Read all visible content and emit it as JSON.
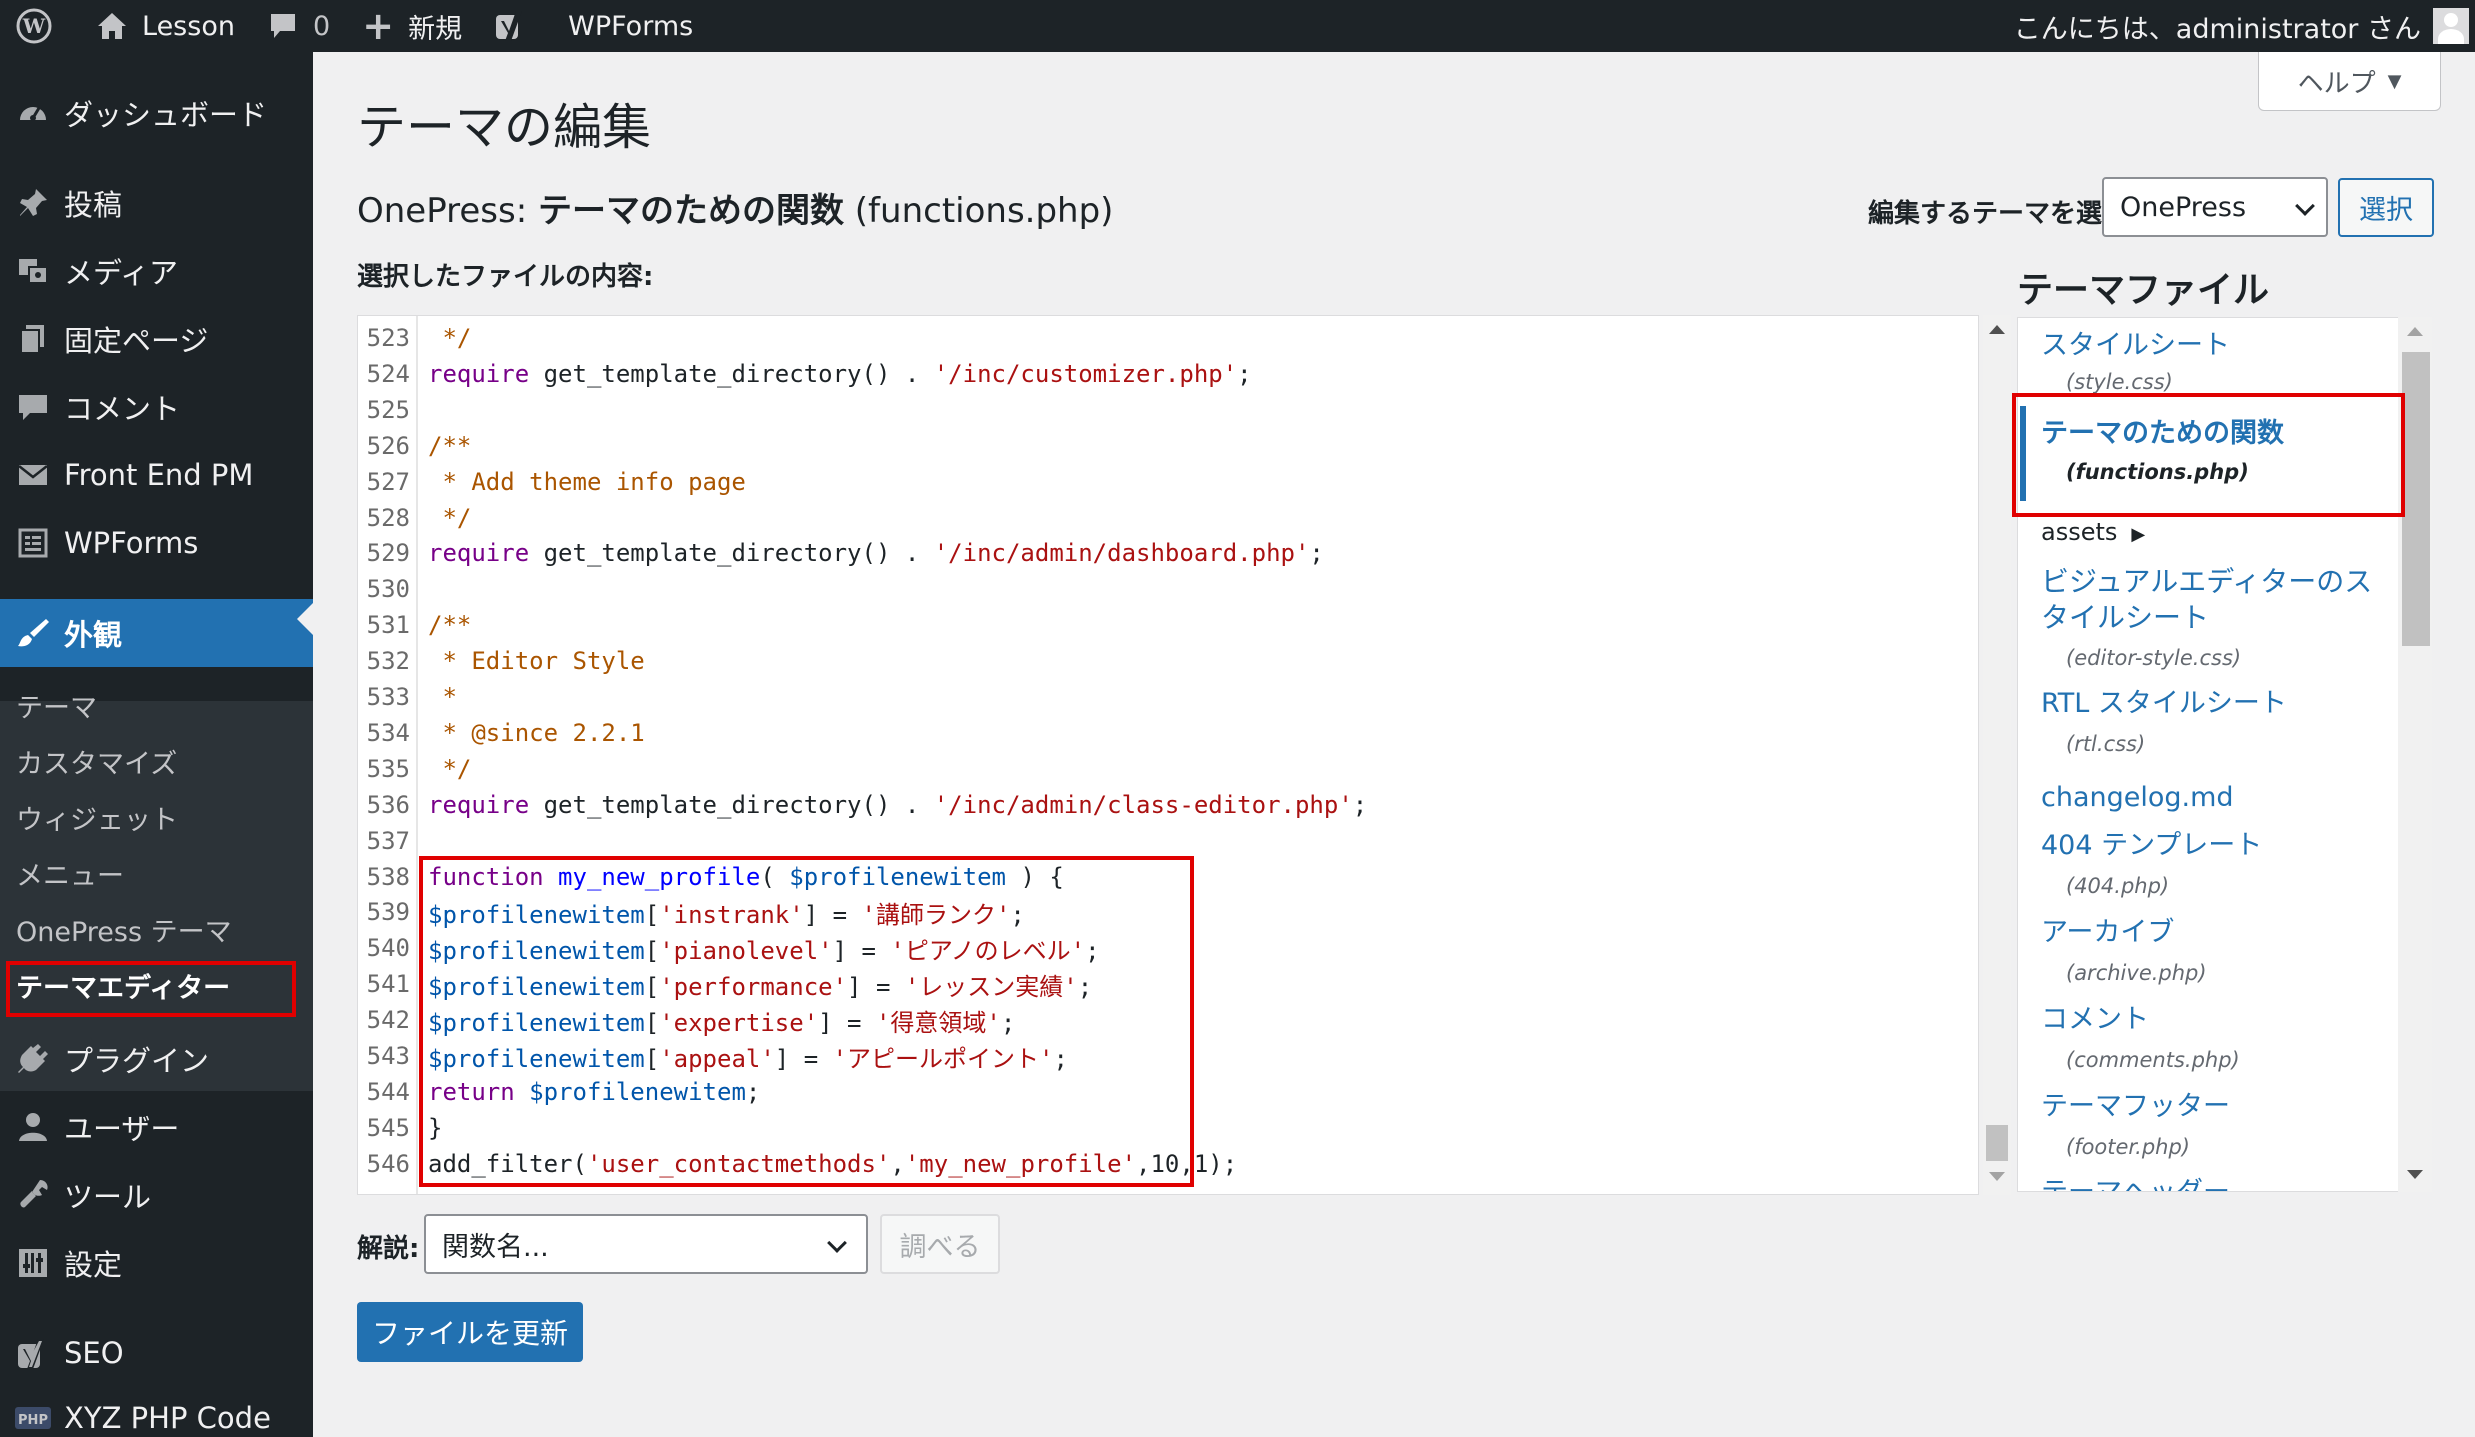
{
  "adminbar": {
    "site_name": "Lesson",
    "comments_count": "0",
    "new_label": "新規",
    "wpforms_label": "WPForms",
    "greeting": "こんにちは、administrator さん"
  },
  "sidebar": {
    "items": [
      {
        "label": "ダッシュボード",
        "icon": "dashboard-icon"
      },
      {
        "label": "投稿",
        "icon": "pin-icon"
      },
      {
        "label": "メディア",
        "icon": "media-icon"
      },
      {
        "label": "固定ページ",
        "icon": "page-icon"
      },
      {
        "label": "コメント",
        "icon": "comment-icon"
      },
      {
        "label": "Front End PM",
        "icon": "mail-icon"
      },
      {
        "label": "WPForms",
        "icon": "forms-icon"
      },
      {
        "label": "外観",
        "icon": "brush-icon"
      },
      {
        "label": "プラグイン",
        "icon": "plugin-icon"
      },
      {
        "label": "ユーザー",
        "icon": "user-icon"
      },
      {
        "label": "ツール",
        "icon": "wrench-icon"
      },
      {
        "label": "設定",
        "icon": "settings-icon"
      },
      {
        "label": "SEO",
        "icon": "yoast-icon"
      },
      {
        "label": "XYZ PHP Code",
        "icon": "php-icon"
      }
    ],
    "submenu": [
      "テーマ",
      "カスタマイズ",
      "ウィジェット",
      "メニュー",
      "OnePress テーマ",
      "テーマエディター"
    ]
  },
  "help_label": "ヘルプ",
  "page_title": "テーマの編集",
  "file_heading": {
    "theme": "OnePress:",
    "file": "テーマのための関数",
    "filename": "(functions.php)"
  },
  "theme_select": {
    "label": "編集するテーマを選択:",
    "value": "OnePress",
    "button": "選択"
  },
  "content_label": "選択したファイルの内容:",
  "code_lines": [
    {
      "n": "523",
      "tokens": [
        {
          "t": " */",
          "c": "com"
        }
      ]
    },
    {
      "n": "524",
      "tokens": [
        {
          "t": "require",
          "c": "kw"
        },
        {
          "t": " get_template_directory() . ",
          "c": "plain"
        },
        {
          "t": "'/inc/customizer.php'",
          "c": "str"
        },
        {
          "t": ";",
          "c": "plain"
        }
      ]
    },
    {
      "n": "525",
      "tokens": []
    },
    {
      "n": "526",
      "tokens": [
        {
          "t": "/**",
          "c": "com"
        }
      ]
    },
    {
      "n": "527",
      "tokens": [
        {
          "t": " * Add theme info page",
          "c": "com"
        }
      ]
    },
    {
      "n": "528",
      "tokens": [
        {
          "t": " */",
          "c": "com"
        }
      ]
    },
    {
      "n": "529",
      "tokens": [
        {
          "t": "require",
          "c": "kw"
        },
        {
          "t": " get_template_directory() . ",
          "c": "plain"
        },
        {
          "t": "'/inc/admin/dashboard.php'",
          "c": "str"
        },
        {
          "t": ";",
          "c": "plain"
        }
      ]
    },
    {
      "n": "530",
      "tokens": []
    },
    {
      "n": "531",
      "tokens": [
        {
          "t": "/**",
          "c": "com"
        }
      ]
    },
    {
      "n": "532",
      "tokens": [
        {
          "t": " * Editor Style",
          "c": "com"
        }
      ]
    },
    {
      "n": "533",
      "tokens": [
        {
          "t": " *",
          "c": "com"
        }
      ]
    },
    {
      "n": "534",
      "tokens": [
        {
          "t": " * @since 2.2.1",
          "c": "com"
        }
      ]
    },
    {
      "n": "535",
      "tokens": [
        {
          "t": " */",
          "c": "com"
        }
      ]
    },
    {
      "n": "536",
      "tokens": [
        {
          "t": "require",
          "c": "kw"
        },
        {
          "t": " get_template_directory() . ",
          "c": "plain"
        },
        {
          "t": "'/inc/admin/class-editor.php'",
          "c": "str"
        },
        {
          "t": ";",
          "c": "plain"
        }
      ]
    },
    {
      "n": "537",
      "tokens": []
    },
    {
      "n": "538",
      "tokens": [
        {
          "t": "function",
          "c": "kw"
        },
        {
          "t": " my_new_profile",
          "c": "def"
        },
        {
          "t": "( ",
          "c": "plain"
        },
        {
          "t": "$profilenewitem",
          "c": "var"
        },
        {
          "t": " ) {",
          "c": "plain"
        }
      ]
    },
    {
      "n": "539",
      "tokens": [
        {
          "t": "$profilenewitem",
          "c": "var"
        },
        {
          "t": "[",
          "c": "plain"
        },
        {
          "t": "'instrank'",
          "c": "str"
        },
        {
          "t": "] = ",
          "c": "plain"
        },
        {
          "t": "'講師ランク'",
          "c": "str"
        },
        {
          "t": ";",
          "c": "plain"
        }
      ]
    },
    {
      "n": "540",
      "tokens": [
        {
          "t": "$profilenewitem",
          "c": "var"
        },
        {
          "t": "[",
          "c": "plain"
        },
        {
          "t": "'pianolevel'",
          "c": "str"
        },
        {
          "t": "] = ",
          "c": "plain"
        },
        {
          "t": "'ピアノのレベル'",
          "c": "str"
        },
        {
          "t": ";",
          "c": "plain"
        }
      ]
    },
    {
      "n": "541",
      "tokens": [
        {
          "t": "$profilenewitem",
          "c": "var"
        },
        {
          "t": "[",
          "c": "plain"
        },
        {
          "t": "'performance'",
          "c": "str"
        },
        {
          "t": "] = ",
          "c": "plain"
        },
        {
          "t": "'レッスン実績'",
          "c": "str"
        },
        {
          "t": ";",
          "c": "plain"
        }
      ]
    },
    {
      "n": "542",
      "tokens": [
        {
          "t": "$profilenewitem",
          "c": "var"
        },
        {
          "t": "[",
          "c": "plain"
        },
        {
          "t": "'expertise'",
          "c": "str"
        },
        {
          "t": "] = ",
          "c": "plain"
        },
        {
          "t": "'得意領域'",
          "c": "str"
        },
        {
          "t": ";",
          "c": "plain"
        }
      ]
    },
    {
      "n": "543",
      "tokens": [
        {
          "t": "$profilenewitem",
          "c": "var"
        },
        {
          "t": "[",
          "c": "plain"
        },
        {
          "t": "'appeal'",
          "c": "str"
        },
        {
          "t": "] = ",
          "c": "plain"
        },
        {
          "t": "'アピールポイント'",
          "c": "str"
        },
        {
          "t": ";",
          "c": "plain"
        }
      ]
    },
    {
      "n": "544",
      "tokens": [
        {
          "t": "return",
          "c": "kw"
        },
        {
          "t": " ",
          "c": "plain"
        },
        {
          "t": "$profilenewitem",
          "c": "var"
        },
        {
          "t": ";",
          "c": "plain"
        }
      ]
    },
    {
      "n": "545",
      "tokens": [
        {
          "t": "}",
          "c": "plain"
        }
      ]
    },
    {
      "n": "546",
      "tokens": [
        {
          "t": "add_filter(",
          "c": "plain"
        },
        {
          "t": "'user_contactmethods'",
          "c": "str"
        },
        {
          "t": ",",
          "c": "plain"
        },
        {
          "t": "'my_new_profile'",
          "c": "str"
        },
        {
          "t": ",10,1);",
          "c": "plain"
        }
      ]
    }
  ],
  "files_title": "テーマファイル",
  "theme_files": [
    {
      "name": "スタイルシート",
      "file": "(style.css)"
    },
    {
      "name": "テーマのための関数",
      "file": "(functions.php)",
      "current": true
    },
    {
      "name": "assets",
      "folder": true
    },
    {
      "name": "ビジュアルエディターのスタイルシート",
      "file": "(editor-style.css)"
    },
    {
      "name": "RTL スタイルシート",
      "file": "(rtl.css)"
    },
    {
      "name": "changelog.md"
    },
    {
      "name": "404 テンプレート",
      "file": "(404.php)"
    },
    {
      "name": "アーカイブ",
      "file": "(archive.php)"
    },
    {
      "name": "コメント",
      "file": "(comments.php)"
    },
    {
      "name": "テーマフッター",
      "file": "(footer.php)"
    },
    {
      "name": "テーマヘッダー"
    }
  ],
  "doc": {
    "label": "解説:",
    "placeholder": "関数名...",
    "lookup": "調べる"
  },
  "update_button": "ファイルを更新",
  "colors": {
    "accent": "#2271b1",
    "sidebar": "#1d2327",
    "highlight": "#e00000"
  }
}
